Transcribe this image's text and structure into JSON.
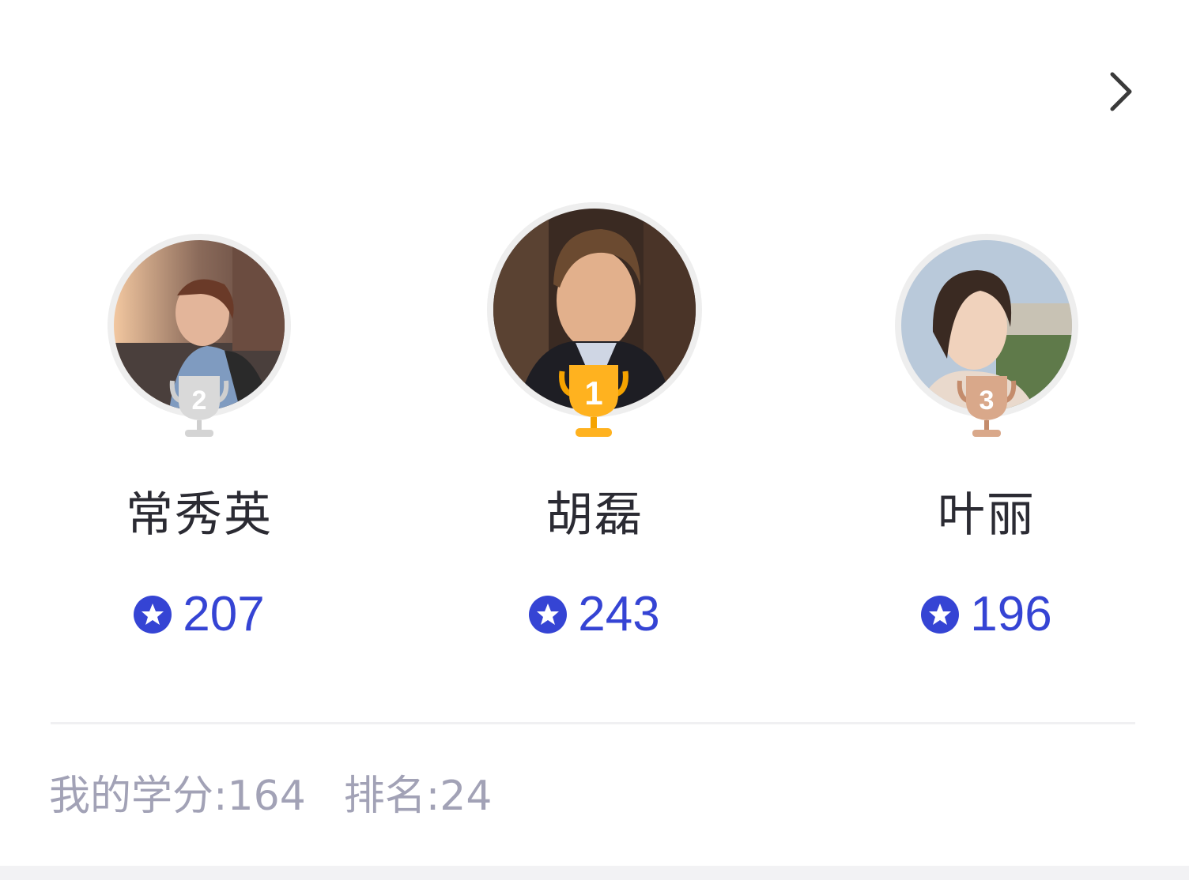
{
  "leaderboard": {
    "more_icon": "chevron-right-icon",
    "podium": [
      {
        "rank": "2",
        "name": "常秀英",
        "score": "207",
        "trophy_color": "#d9d9d9",
        "trophy_shade": "#bdbdbd"
      },
      {
        "rank": "1",
        "name": "胡磊",
        "score": "243",
        "trophy_color": "#ffb21f",
        "trophy_shade": "#f59a00"
      },
      {
        "rank": "3",
        "name": "叶丽",
        "score": "196",
        "trophy_color": "#d9a88a",
        "trophy_shade": "#c48c6c"
      }
    ],
    "score_icon": "star-coin-icon",
    "accent_color": "#3544d4"
  },
  "summary": {
    "my_credits": "我的学分:164",
    "my_rank": "排名:24"
  }
}
